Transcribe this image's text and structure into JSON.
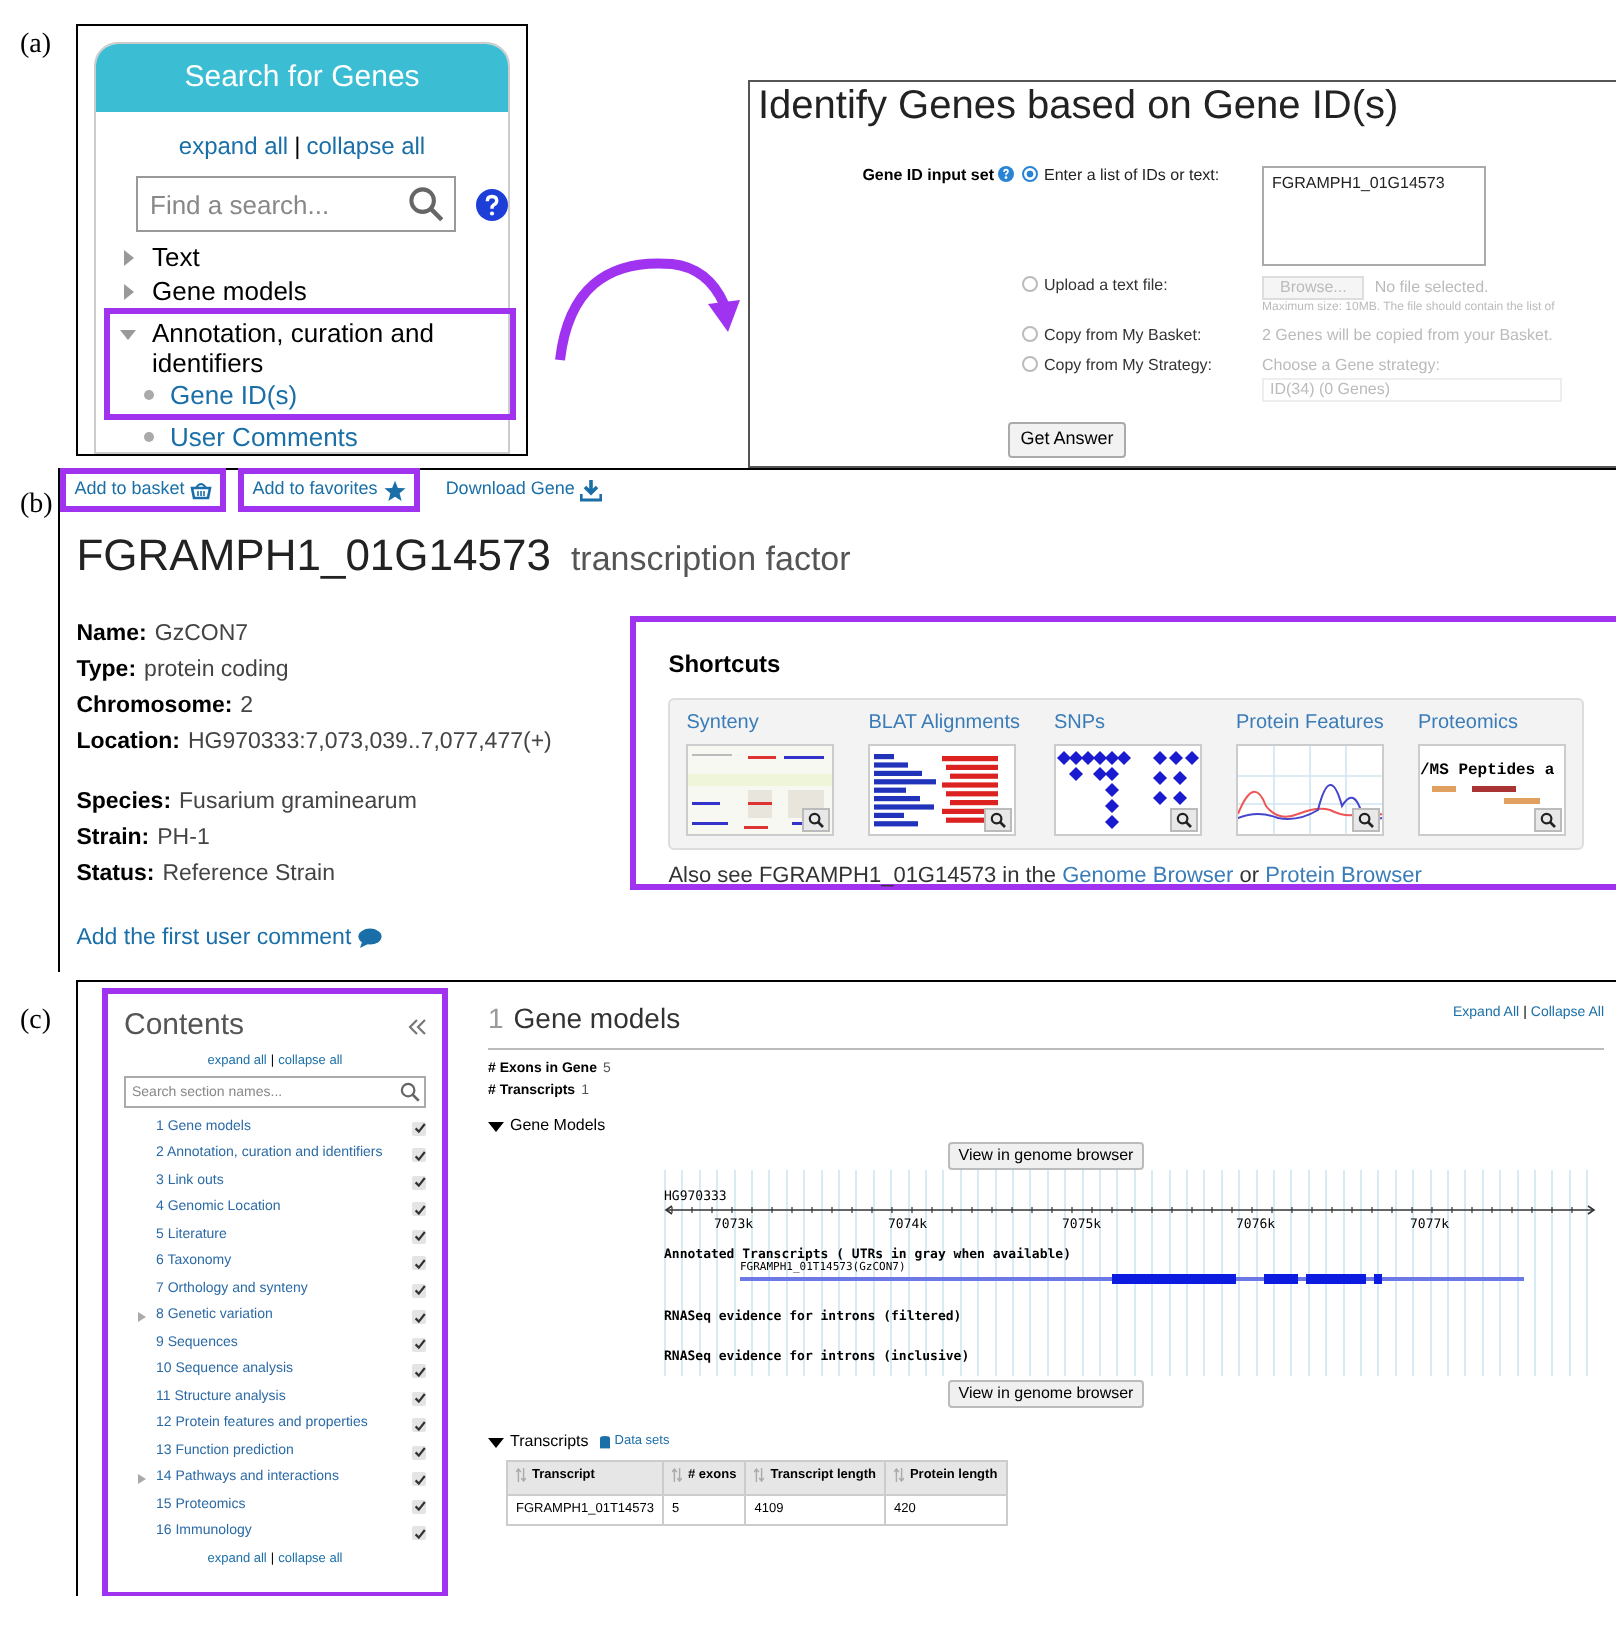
{
  "panel_a": {
    "label": "(a)",
    "search_panel": {
      "title": "Search for Genes",
      "expand_all": "expand all",
      "separator": "|",
      "collapse_all": "collapse all",
      "search_placeholder": "Find a search...",
      "tree": [
        {
          "label": "Text",
          "expanded": false,
          "highlighted": false
        },
        {
          "label": "Gene models",
          "expanded": false,
          "highlighted": false
        },
        {
          "label": "Annotation, curation and identifiers",
          "expanded": true,
          "highlighted": true,
          "children": [
            {
              "label": "Gene ID(s)",
              "highlighted": true
            },
            {
              "label": "User Comments",
              "highlighted": false
            }
          ]
        }
      ]
    },
    "form": {
      "title": "Identify Genes based on Gene ID(s)",
      "field_label": "Gene ID input set",
      "options": [
        {
          "kind": "textarea",
          "label": "Enter a list of IDs or text:",
          "selected": true,
          "disabled": false,
          "value": "FGRAMPH1_01G14573"
        },
        {
          "kind": "file",
          "label": "Upload a text file:",
          "selected": false,
          "disabled": true,
          "button": "Browse...",
          "status": "No file selected.",
          "note": "Maximum size: 10MB. The file should contain the list of"
        },
        {
          "kind": "text",
          "label": "Copy from My Basket:",
          "selected": false,
          "disabled": true,
          "text": "2 Genes will be copied from your Basket."
        },
        {
          "kind": "select",
          "label": "Copy from My Strategy:",
          "selected": false,
          "disabled": true,
          "text": "Choose a Gene strategy:",
          "value": "ID(34) (0 Genes)"
        }
      ],
      "submit": "Get Answer"
    }
  },
  "panel_b": {
    "label": "(b)",
    "actions": [
      {
        "kind": "basket",
        "label": "Add to basket",
        "highlighted": true
      },
      {
        "kind": "favorite",
        "label": "Add to favorites",
        "highlighted": true
      },
      {
        "kind": "download",
        "label": "Download Gene",
        "highlighted": false
      }
    ],
    "gene_id": "FGRAMPH1_01G14573",
    "product": "transcription factor",
    "field_groups": [
      [
        {
          "label": "Name:",
          "value": "GzCON7"
        },
        {
          "label": "Type:",
          "value": "protein coding"
        },
        {
          "label": "Chromosome:",
          "value": "2"
        },
        {
          "label": "Location:",
          "value": "HG970333:7,073,039..7,077,477(+)"
        }
      ],
      [
        {
          "label": "Species:",
          "value": "Fusarium graminearum"
        },
        {
          "label": "Strain:",
          "value": "PH-1"
        },
        {
          "label": "Status:",
          "value": "Reference Strain"
        }
      ]
    ],
    "comment_link": "Add the first user comment",
    "shortcuts": {
      "title": "Shortcuts",
      "highlighted": true,
      "items": [
        {
          "kind": "synteny",
          "label": "Synteny"
        },
        {
          "kind": "blat",
          "label": "BLAT Alignments"
        },
        {
          "kind": "snps",
          "label": "SNPs"
        },
        {
          "kind": "protein",
          "label": "Protein Features"
        },
        {
          "kind": "proteomics",
          "label": "Proteomics",
          "thumbnail_text": "/MS Peptides a"
        }
      ],
      "note_parts": [
        {
          "kind": "text",
          "text": "Also see FGRAMPH1_01G14573 in the"
        },
        {
          "kind": "link",
          "text": "Genome Browser"
        },
        {
          "kind": "text",
          "text": "or"
        },
        {
          "kind": "link",
          "text": "Protein Browser"
        }
      ]
    }
  },
  "panel_c": {
    "label": "(c)",
    "contents": {
      "title": "Contents",
      "highlighted": true,
      "expand_all": "expand all",
      "separator": "|",
      "collapse_all": "collapse all",
      "search_placeholder": "Search section names...",
      "sections": [
        {
          "label": "1 Gene models",
          "checked": true,
          "expandable": false
        },
        {
          "label": "2 Annotation, curation and identifiers",
          "checked": true,
          "expandable": false
        },
        {
          "label": "3 Link outs",
          "checked": true,
          "expandable": false
        },
        {
          "label": "4 Genomic Location",
          "checked": true,
          "expandable": false
        },
        {
          "label": "5 Literature",
          "checked": true,
          "expandable": false
        },
        {
          "label": "6 Taxonomy",
          "checked": true,
          "expandable": false
        },
        {
          "label": "7 Orthology and synteny",
          "checked": true,
          "expandable": false
        },
        {
          "label": "8 Genetic variation",
          "checked": true,
          "expandable": true
        },
        {
          "label": "9 Sequences",
          "checked": true,
          "expandable": false
        },
        {
          "label": "10 Sequence analysis",
          "checked": true,
          "expandable": false
        },
        {
          "label": "11 Structure analysis",
          "checked": true,
          "expandable": false
        },
        {
          "label": "12 Protein features and properties",
          "checked": true,
          "expandable": false
        },
        {
          "label": "13 Function prediction",
          "checked": true,
          "expandable": false
        },
        {
          "label": "14 Pathways and interactions",
          "checked": true,
          "expandable": true
        },
        {
          "label": "15 Proteomics",
          "checked": true,
          "expandable": false
        },
        {
          "label": "16 Immunology",
          "checked": true,
          "expandable": false
        }
      ],
      "footer_expand_all": "expand all",
      "footer_separator": "|",
      "footer_collapse_all": "collapse all"
    },
    "section": {
      "number": "1",
      "title": "Gene models",
      "expand_all": "Expand All",
      "separator": "|",
      "collapse_all": "Collapse All",
      "stats": [
        {
          "label": "# Exons in Gene",
          "value": "5"
        },
        {
          "label": "# Transcripts",
          "value": "1"
        }
      ],
      "gene_models": {
        "title": "Gene Models",
        "expanded": true,
        "button_top": "View in genome browser",
        "button_bottom": "View in genome browser",
        "track": {
          "sequence": "HG970333",
          "ticks": [
            "7073k",
            "7074k",
            "7075k",
            "7076k",
            "7077k"
          ],
          "annotated_label": "Annotated Transcripts ( UTRs in gray when available)",
          "transcript_label": "FGRAMPH1_01T14573(GzCON7)",
          "rnaseq_labels": [
            "RNASeq evidence for introns (filtered)",
            "RNASeq evidence for introns (inclusive)"
          ]
        }
      },
      "transcripts": {
        "title": "Transcripts",
        "expanded": true,
        "datasets_link": "Data sets",
        "columns": [
          "Transcript",
          "# exons",
          "Transcript length",
          "Protein length"
        ],
        "rows": [
          [
            "FGRAMPH1_01T14573",
            "5",
            "4109",
            "420"
          ]
        ]
      }
    }
  }
}
